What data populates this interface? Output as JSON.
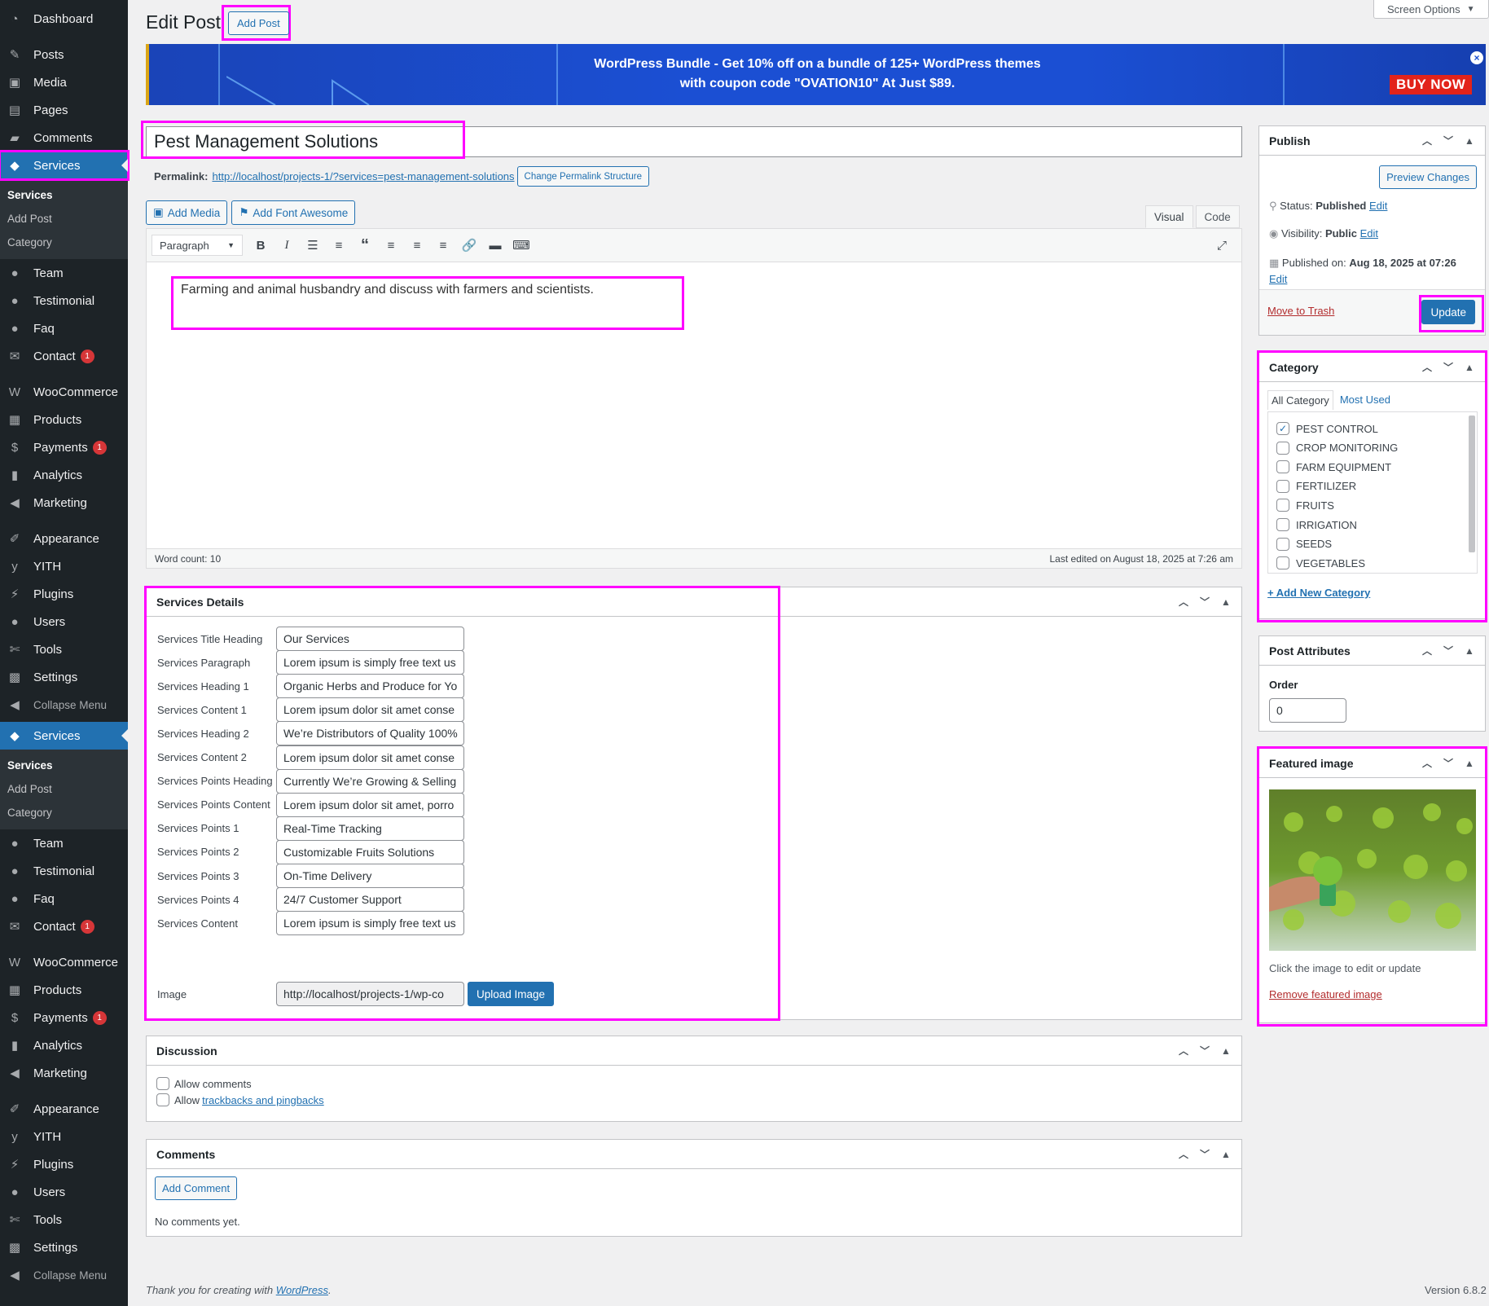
{
  "sidebar": {
    "menu1": [
      {
        "label": "Dashboard",
        "icon": "dashboard-icon",
        "glyph": "◔"
      },
      {
        "label": "Posts",
        "icon": "pin-icon",
        "glyph": "✎"
      },
      {
        "label": "Media",
        "icon": "media-icon",
        "glyph": "▣"
      },
      {
        "label": "Pages",
        "icon": "pages-icon",
        "glyph": "▤"
      },
      {
        "label": "Comments",
        "icon": "comment-icon",
        "glyph": "▰"
      },
      {
        "label": "Services",
        "icon": "tag-icon",
        "glyph": "◆"
      }
    ],
    "submenu": {
      "title": "Services",
      "add": "Add Post",
      "category": "Category"
    },
    "menu2": [
      {
        "label": "Team",
        "icon": "user-icon",
        "glyph": "●"
      },
      {
        "label": "Testimonial",
        "icon": "user-icon",
        "glyph": "●"
      },
      {
        "label": "Faq",
        "icon": "user-icon",
        "glyph": "●"
      },
      {
        "label": "Contact",
        "icon": "mail-icon",
        "glyph": "✉",
        "badge": "1"
      }
    ],
    "menu3": [
      {
        "label": "WooCommerce",
        "icon": "woo-icon",
        "glyph": "W"
      },
      {
        "label": "Products",
        "icon": "archive-icon",
        "glyph": "▦"
      },
      {
        "label": "Payments",
        "icon": "dollar-icon",
        "glyph": "$",
        "badge": "1"
      },
      {
        "label": "Analytics",
        "icon": "chart-icon",
        "glyph": "▮"
      },
      {
        "label": "Marketing",
        "icon": "megaphone-icon",
        "glyph": "◀"
      }
    ],
    "menu4": [
      {
        "label": "Appearance",
        "icon": "brush-icon",
        "glyph": "✐"
      },
      {
        "label": "YITH",
        "icon": "yith-icon",
        "glyph": "y"
      },
      {
        "label": "Plugins",
        "icon": "plug-icon",
        "glyph": "⚡"
      },
      {
        "label": "Users",
        "icon": "user-icon",
        "glyph": "●"
      },
      {
        "label": "Tools",
        "icon": "wrench-icon",
        "glyph": "✄"
      },
      {
        "label": "Settings",
        "icon": "settings-icon",
        "glyph": "▩"
      }
    ],
    "collapse": "Collapse Menu"
  },
  "header": {
    "screen_options": "Screen Options",
    "title": "Edit Post",
    "add_post": "Add Post"
  },
  "banner": {
    "line1": "WordPress Bundle - Get 10% off on a bundle of 125+ WordPress themes",
    "line2": "with coupon code \"OVATION10\" At Just $89.",
    "buy_now": "BUY NOW",
    "close": "×"
  },
  "post": {
    "title": "Pest Management Solutions",
    "permalink_label": "Permalink:",
    "permalink_url": "http://localhost/projects-1/?services=pest-management-solutions",
    "change_permalink": "Change Permalink Structure"
  },
  "editor": {
    "add_media": "Add Media",
    "add_font_awesome": "Add Font Awesome",
    "tab_visual": "Visual",
    "tab_code": "Code",
    "format": "Paragraph",
    "content": "Farming and animal husbandry and discuss with farmers and scientists.",
    "word_count": "Word count: 10",
    "last_edited": "Last edited on August 18, 2025 at 7:26 am"
  },
  "services_details": {
    "title": "Services Details",
    "fields": [
      {
        "label": "Services Title Heading",
        "value": "Our Services"
      },
      {
        "label": "Services Paragraph",
        "value": "Lorem ipsum is simply free text us"
      },
      {
        "label": "Services Heading 1",
        "value": "Organic Herbs and Produce for Yo"
      },
      {
        "label": "Services Content 1",
        "value": " Lorem ipsum dolor sit amet conse"
      },
      {
        "label": "Services Heading 2",
        "value": "We’re Distributors of Quality 100%"
      },
      {
        "label": "Services Content 2",
        "value": " Lorem ipsum dolor sit amet conse"
      },
      {
        "label": "Services Points Heading",
        "value": "Currently We’re Growing & Selling"
      },
      {
        "label": "Services Points Content",
        "value": "Lorem ipsum dolor sit amet, porro"
      },
      {
        "label": "Services Points 1",
        "value": "Real-Time Tracking"
      },
      {
        "label": "Services Points 2",
        "value": "Customizable Fruits Solutions"
      },
      {
        "label": "Services Points 3",
        "value": "On-Time Delivery"
      },
      {
        "label": "Services Points 4",
        "value": "24/7 Customer Support"
      },
      {
        "label": "Services Content",
        "value": "Lorem ipsum is simply free text us"
      }
    ],
    "image_label": "Image",
    "image_value": "http://localhost/projects-1/wp-co",
    "upload": "Upload Image"
  },
  "discussion": {
    "title": "Discussion",
    "allow_comments": "Allow comments",
    "allow_prefix": "Allow",
    "trackbacks": "trackbacks and pingbacks"
  },
  "comments": {
    "title": "Comments",
    "add": "Add Comment",
    "none": "No comments yet."
  },
  "publish": {
    "title": "Publish",
    "preview": "Preview Changes",
    "status_label": "Status:",
    "status_value": "Published",
    "visibility_label": "Visibility:",
    "visibility_value": "Public",
    "published_label": "Published on:",
    "published_value": "Aug 18, 2025 at 07:26",
    "edit": "Edit",
    "trash": "Move to Trash",
    "update": "Update"
  },
  "category": {
    "title": "Category",
    "tab_all": "All Category",
    "tab_used": "Most Used",
    "items": [
      {
        "label": "PEST CONTROL",
        "checked": true
      },
      {
        "label": "CROP MONITORING",
        "checked": false
      },
      {
        "label": "FARM EQUIPMENT",
        "checked": false
      },
      {
        "label": "FERTILIZER",
        "checked": false
      },
      {
        "label": "FRUITS",
        "checked": false
      },
      {
        "label": "IRRIGATION",
        "checked": false
      },
      {
        "label": "SEEDS",
        "checked": false
      },
      {
        "label": "VEGETABLES",
        "checked": false
      }
    ],
    "add_new": "+ Add New Category"
  },
  "attributes": {
    "title": "Post Attributes",
    "order_label": "Order",
    "order_value": "0"
  },
  "featured": {
    "title": "Featured image",
    "hint": "Click the image to edit or update",
    "remove": "Remove featured image"
  },
  "footer": {
    "thanks_prefix": "Thank you for creating with",
    "wp": "WordPress",
    "thanks_suffix": ".",
    "version": "Version 6.8.2"
  },
  "colors": {
    "sidebar_bg": "#1d2327",
    "accent": "#2271b1",
    "highlight": "#ff00ff",
    "danger": "#d63638"
  }
}
